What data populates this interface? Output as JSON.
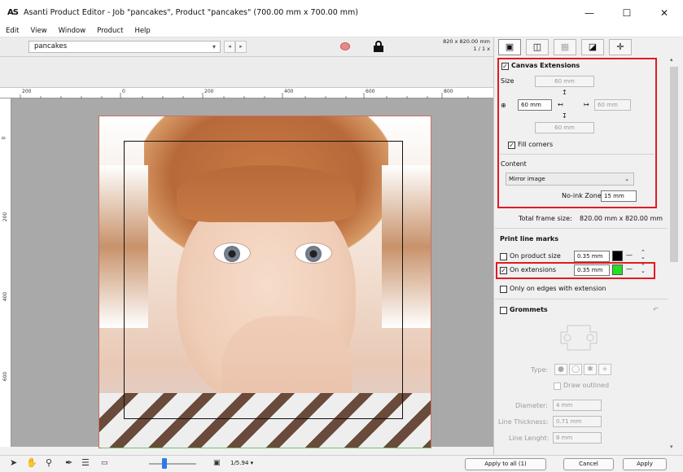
{
  "window": {
    "app_icon": "AS",
    "title": "Asanti Product Editor - Job \"pancakes\", Product \"pancakes\" (700.00 mm x 700.00 mm)",
    "minimize": "—",
    "maximize": "☐",
    "close": "✕"
  },
  "menu": [
    "Edit",
    "View",
    "Window",
    "Product",
    "Help"
  ],
  "toolbar": {
    "job_select": "pancakes",
    "size_line1": "820 x 820.00 mm",
    "size_line2": "1 / 1 x"
  },
  "ruler": {
    "h_labels": [
      "200",
      "0",
      "200",
      "400",
      "600",
      "800"
    ],
    "v_labels": [
      "0",
      "200",
      "400",
      "600"
    ]
  },
  "panel": {
    "canvas_extensions": {
      "label": "Canvas Extensions",
      "checked": true,
      "size_label": "Size",
      "top": "60 mm",
      "left": "60 mm",
      "right": "60 mm",
      "bottom": "60 mm",
      "fill_corners_label": "Fill corners",
      "fill_corners_checked": true,
      "content_label": "Content",
      "content_value": "Mirror image",
      "no_ink_label": "No-ink Zone",
      "no_ink_value": "15 mm"
    },
    "total_frame_label": "Total frame size:",
    "total_frame_value": "820.00 mm x 820.00 mm",
    "print_line_marks": {
      "label": "Print line marks",
      "on_product_size_label": "On product size",
      "on_product_size_checked": false,
      "on_product_size_value": "0.35 mm",
      "on_product_size_color": "#000000",
      "on_extensions_label": "On extensions",
      "on_extensions_checked": true,
      "on_extensions_value": "0.35 mm",
      "on_extensions_color": "#22e022",
      "only_edges_label": "Only on edges with extension",
      "only_edges_checked": false
    },
    "grommets": {
      "label": "Grommets",
      "checked": false,
      "type_label": "Type:",
      "draw_outlined_label": "Draw outlined",
      "diameter_label": "Diameter:",
      "diameter_value": "4 mm",
      "line_thickness_label": "Line Thickness:",
      "line_thickness_value": "0.71 mm",
      "line_length_label": "Line Lenght:",
      "line_length_value": "8 mm"
    }
  },
  "bottom": {
    "zoom_value": "1/5.94 ▾",
    "apply_all": "Apply to all (1)",
    "cancel": "Cancel",
    "apply": "Apply"
  },
  "colors": {
    "highlight": "#e01b24",
    "zoom_thumb": "#2d7be8"
  }
}
